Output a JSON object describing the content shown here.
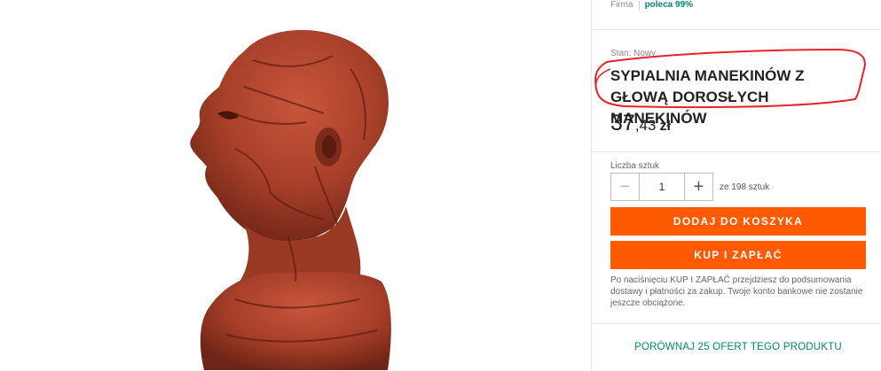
{
  "seller": {
    "firm_label": "Firma",
    "recommend": "poleca 99%"
  },
  "product": {
    "state": "Stan: Nowy",
    "title": "SYPIALNIA MANEKINÓW Z GŁOWĄ DOROSŁYCH MANEKINÓW",
    "price_int": "37",
    "price_dec": ",43",
    "currency": "zł",
    "image_icon": "anatomical-head-bust-image"
  },
  "quantity": {
    "label": "Liczba sztuk",
    "value": "1",
    "minus": "−",
    "plus": "+",
    "of_text": "ze 198 sztuk"
  },
  "buttons": {
    "add_to_cart": "DODAJ DO KOSZYKA",
    "buy_and_pay": "KUP I ZAPŁAĆ"
  },
  "note": "Po naciśnięciu KUP I ZAPŁAĆ przejdziesz do podsumowania dostawy i płatności za zakup. Twoje konto bankowe nie zostanie jeszcze obciążone.",
  "compare": "PORÓWNAJ 25 OFERT TEGO PRODUKTU",
  "colors": {
    "accent": "#ff5a00",
    "link": "#008673",
    "annotation": "#e8222a"
  }
}
